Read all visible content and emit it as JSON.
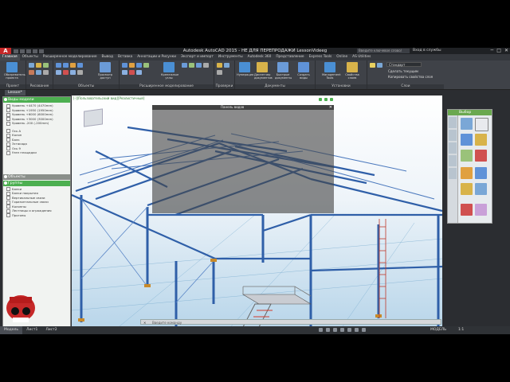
{
  "app": {
    "logo": "A",
    "window_title": "Autodesk AutoCAD 2015 - НЕ ДЛЯ ПЕРЕПРОДАЖИ    LessonVideeg",
    "search_placeholder": "Введите ключевое слово/фразу",
    "user_label": "Вход в службы",
    "min": "─",
    "max": "□",
    "close": "✕"
  },
  "ribbon_tabs": [
    "Главная",
    "Объекты",
    "Расширенное моделирование",
    "Вывод",
    "Вставка",
    "Аннотации и Рисунки",
    "Экспорт и импорт",
    "Инструменты",
    "Autodesk 360",
    "Представление",
    "Express Tools",
    "Online",
    "AS Utilities"
  ],
  "ribbon_groups": {
    "project": "Проект",
    "view": "Рисование",
    "objects": "Объекты",
    "advanced": "Расширенное моделирование",
    "checks": "Проверки",
    "documents": "Документы",
    "settings": "Установки",
    "layers": "Слои"
  },
  "ribbon_buttons": {
    "project_browser": "Обозреватель проекта",
    "beam_view": "Просмотр доступ",
    "connections": "Крепежные узлы",
    "numbering": "Нумерация",
    "document_manager": "Диспетчер документов",
    "quick_docs": "Быстрые документы",
    "create_views": "Создать виды",
    "management": "Management Tools",
    "props": "Свойства слоев",
    "layer_standard": "Стандарт",
    "make_current": "Сделать текущим",
    "match_layer": "Копировать свойства слоя"
  },
  "doc_tab": "Lesson*",
  "palette": {
    "section1": "Виды модели",
    "views": [
      "Уровень +4470 (4470mm)",
      "Уровень +1950 (1950mm)",
      "Уровень +6000 (6000mm)",
      "Уровень +3000 (3000mm)",
      "Уровень -200 (-200mm)"
    ],
    "section1b": [
      "Ось А",
      "Колон",
      "Балк",
      "Эстакада",
      "Ось 9",
      "Узел площадки"
    ],
    "section2": "Объекты",
    "section3": "Группы",
    "groups": [
      "Балки",
      "Балки покрытия",
      "Вертикальные связи",
      "Горизонтальные связи",
      "Колонны",
      "Лестницы и ограждения",
      "Прогоны"
    ]
  },
  "viewport": {
    "label": "[-][Пользовательский вид][Реалистичный]",
    "overlay_title": "Панель видов"
  },
  "right_palette": {
    "title": "Выбор"
  },
  "command": {
    "placeholder": "Введите команду"
  },
  "status_tabs": [
    "Модель",
    "Лист1",
    "Лист2"
  ],
  "status": {
    "model": "МОДЕЛЬ",
    "scale": "1:1"
  }
}
